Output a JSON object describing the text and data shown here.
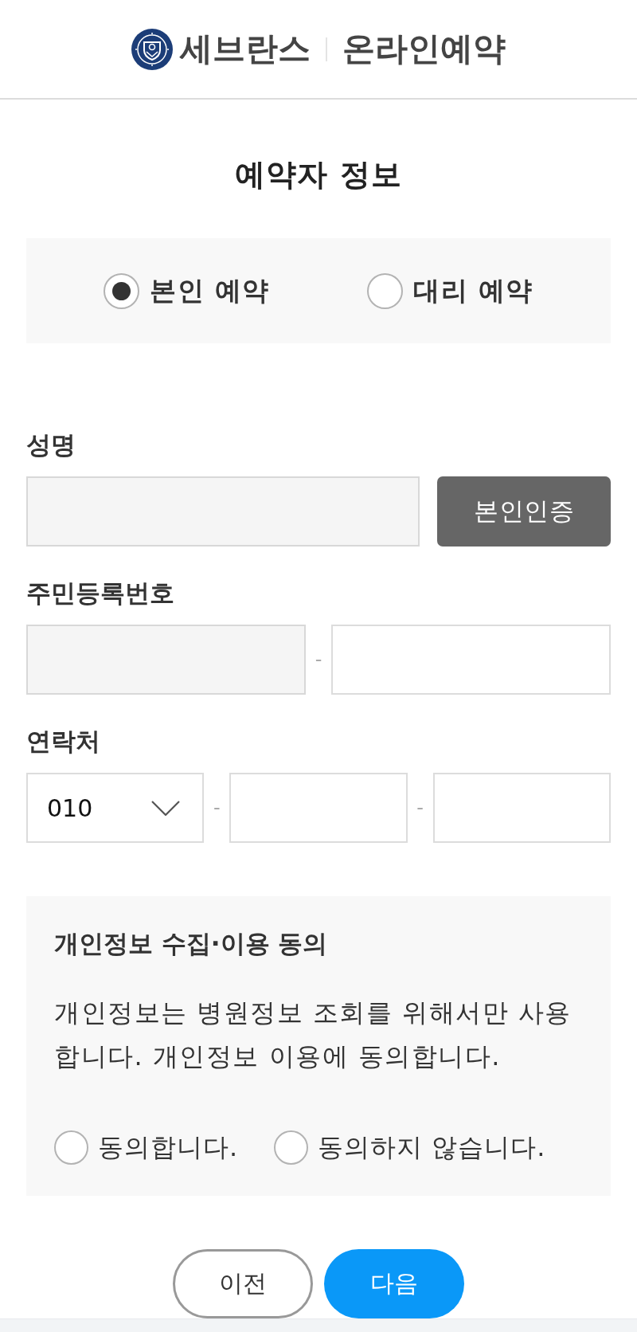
{
  "header": {
    "brand": "세브란스",
    "service": "온라인예약"
  },
  "title": "예약자 정보",
  "booking_type": [
    {
      "label": "본인 예약",
      "selected": true
    },
    {
      "label": "대리 예약",
      "selected": false
    }
  ],
  "fields": [
    {
      "label": "성명",
      "parts": [
        {
          "kind": "readonly_input"
        },
        {
          "kind": "button",
          "text": "본인인증"
        }
      ]
    },
    {
      "label": "주민등록번호",
      "parts": [
        {
          "kind": "readonly_input"
        },
        {
          "kind": "separator",
          "text": "-"
        },
        {
          "kind": "input"
        }
      ]
    },
    {
      "label": "연락처",
      "parts": [
        {
          "kind": "select",
          "value": "010"
        },
        {
          "kind": "separator",
          "text": "-"
        },
        {
          "kind": "input"
        },
        {
          "kind": "separator",
          "text": "-"
        },
        {
          "kind": "input"
        }
      ]
    }
  ],
  "consent": {
    "title": "개인정보 수집·이용 동의",
    "text": "개인정보는 병원정보 조회를 위해서만 사용합니다. 개인정보 이용에 동의합니다.",
    "options": [
      {
        "label": "동의합니다.",
        "selected": false
      },
      {
        "label": "동의하지 않습니다.",
        "selected": false
      }
    ]
  },
  "buttons": [
    {
      "label": "이전",
      "kind": "secondary"
    },
    {
      "label": "다음",
      "kind": "primary"
    }
  ]
}
